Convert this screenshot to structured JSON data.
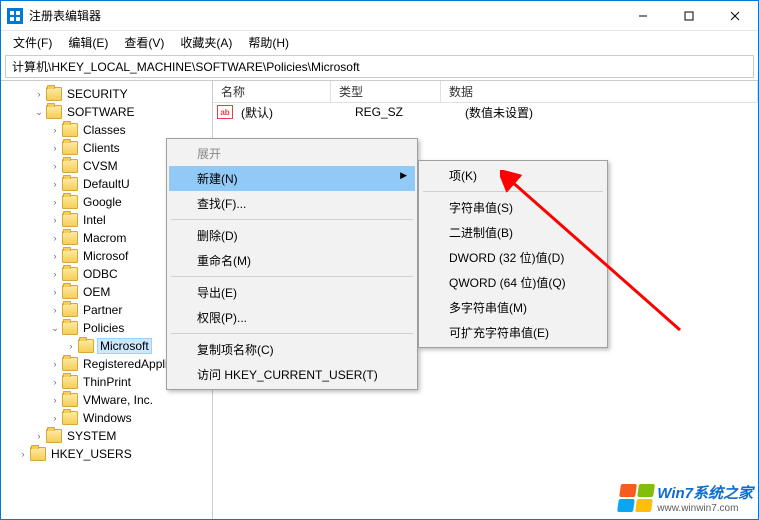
{
  "window": {
    "title": "注册表编辑器"
  },
  "menu": {
    "file": "文件(F)",
    "edit": "编辑(E)",
    "view": "查看(V)",
    "favorites": "收藏夹(A)",
    "help": "帮助(H)"
  },
  "address": "计算机\\HKEY_LOCAL_MACHINE\\SOFTWARE\\Policies\\Microsoft",
  "tree": {
    "items": [
      {
        "indent": 2,
        "twisty": "›",
        "label": "SECURITY"
      },
      {
        "indent": 2,
        "twisty": "⌄",
        "label": "SOFTWARE"
      },
      {
        "indent": 3,
        "twisty": "›",
        "label": "Classes"
      },
      {
        "indent": 3,
        "twisty": "›",
        "label": "Clients"
      },
      {
        "indent": 3,
        "twisty": "›",
        "label": "CVSM"
      },
      {
        "indent": 3,
        "twisty": "›",
        "label": "DefaultU"
      },
      {
        "indent": 3,
        "twisty": "›",
        "label": "Google"
      },
      {
        "indent": 3,
        "twisty": "›",
        "label": "Intel"
      },
      {
        "indent": 3,
        "twisty": "›",
        "label": "Macrom"
      },
      {
        "indent": 3,
        "twisty": "›",
        "label": "Microsof"
      },
      {
        "indent": 3,
        "twisty": "›",
        "label": "ODBC"
      },
      {
        "indent": 3,
        "twisty": "›",
        "label": "OEM"
      },
      {
        "indent": 3,
        "twisty": "›",
        "label": "Partner"
      },
      {
        "indent": 3,
        "twisty": "⌄",
        "label": "Policies"
      },
      {
        "indent": 4,
        "twisty": "›",
        "label": "Microsoft",
        "selected": true
      },
      {
        "indent": 3,
        "twisty": "›",
        "label": "RegisteredApplica"
      },
      {
        "indent": 3,
        "twisty": "›",
        "label": "ThinPrint"
      },
      {
        "indent": 3,
        "twisty": "›",
        "label": "VMware, Inc."
      },
      {
        "indent": 3,
        "twisty": "›",
        "label": "Windows"
      },
      {
        "indent": 2,
        "twisty": "›",
        "label": "SYSTEM"
      },
      {
        "indent": 1,
        "twisty": "›",
        "label": "HKEY_USERS"
      }
    ]
  },
  "list": {
    "cols": {
      "name": "名称",
      "type": "类型",
      "data": "数据"
    },
    "rows": [
      {
        "icon": "ab",
        "name": "(默认)",
        "type": "REG_SZ",
        "data": "(数值未设置)"
      }
    ]
  },
  "ctx1": {
    "expand": "展开",
    "new_": "新建(N)",
    "find": "查找(F)...",
    "delete_": "删除(D)",
    "rename": "重命名(M)",
    "export_": "导出(E)",
    "perm": "权限(P)...",
    "copykey": "复制项名称(C)",
    "goto": "访问 HKEY_CURRENT_USER(T)"
  },
  "ctx2": {
    "key": "项(K)",
    "string": "字符串值(S)",
    "binary": "二进制值(B)",
    "dword": "DWORD (32 位)值(D)",
    "qword": "QWORD (64 位)值(Q)",
    "multi": "多字符串值(M)",
    "expand": "可扩充字符串值(E)"
  },
  "watermark": {
    "line1": "Win7系统之家",
    "line2": "www.winwin7.com"
  }
}
